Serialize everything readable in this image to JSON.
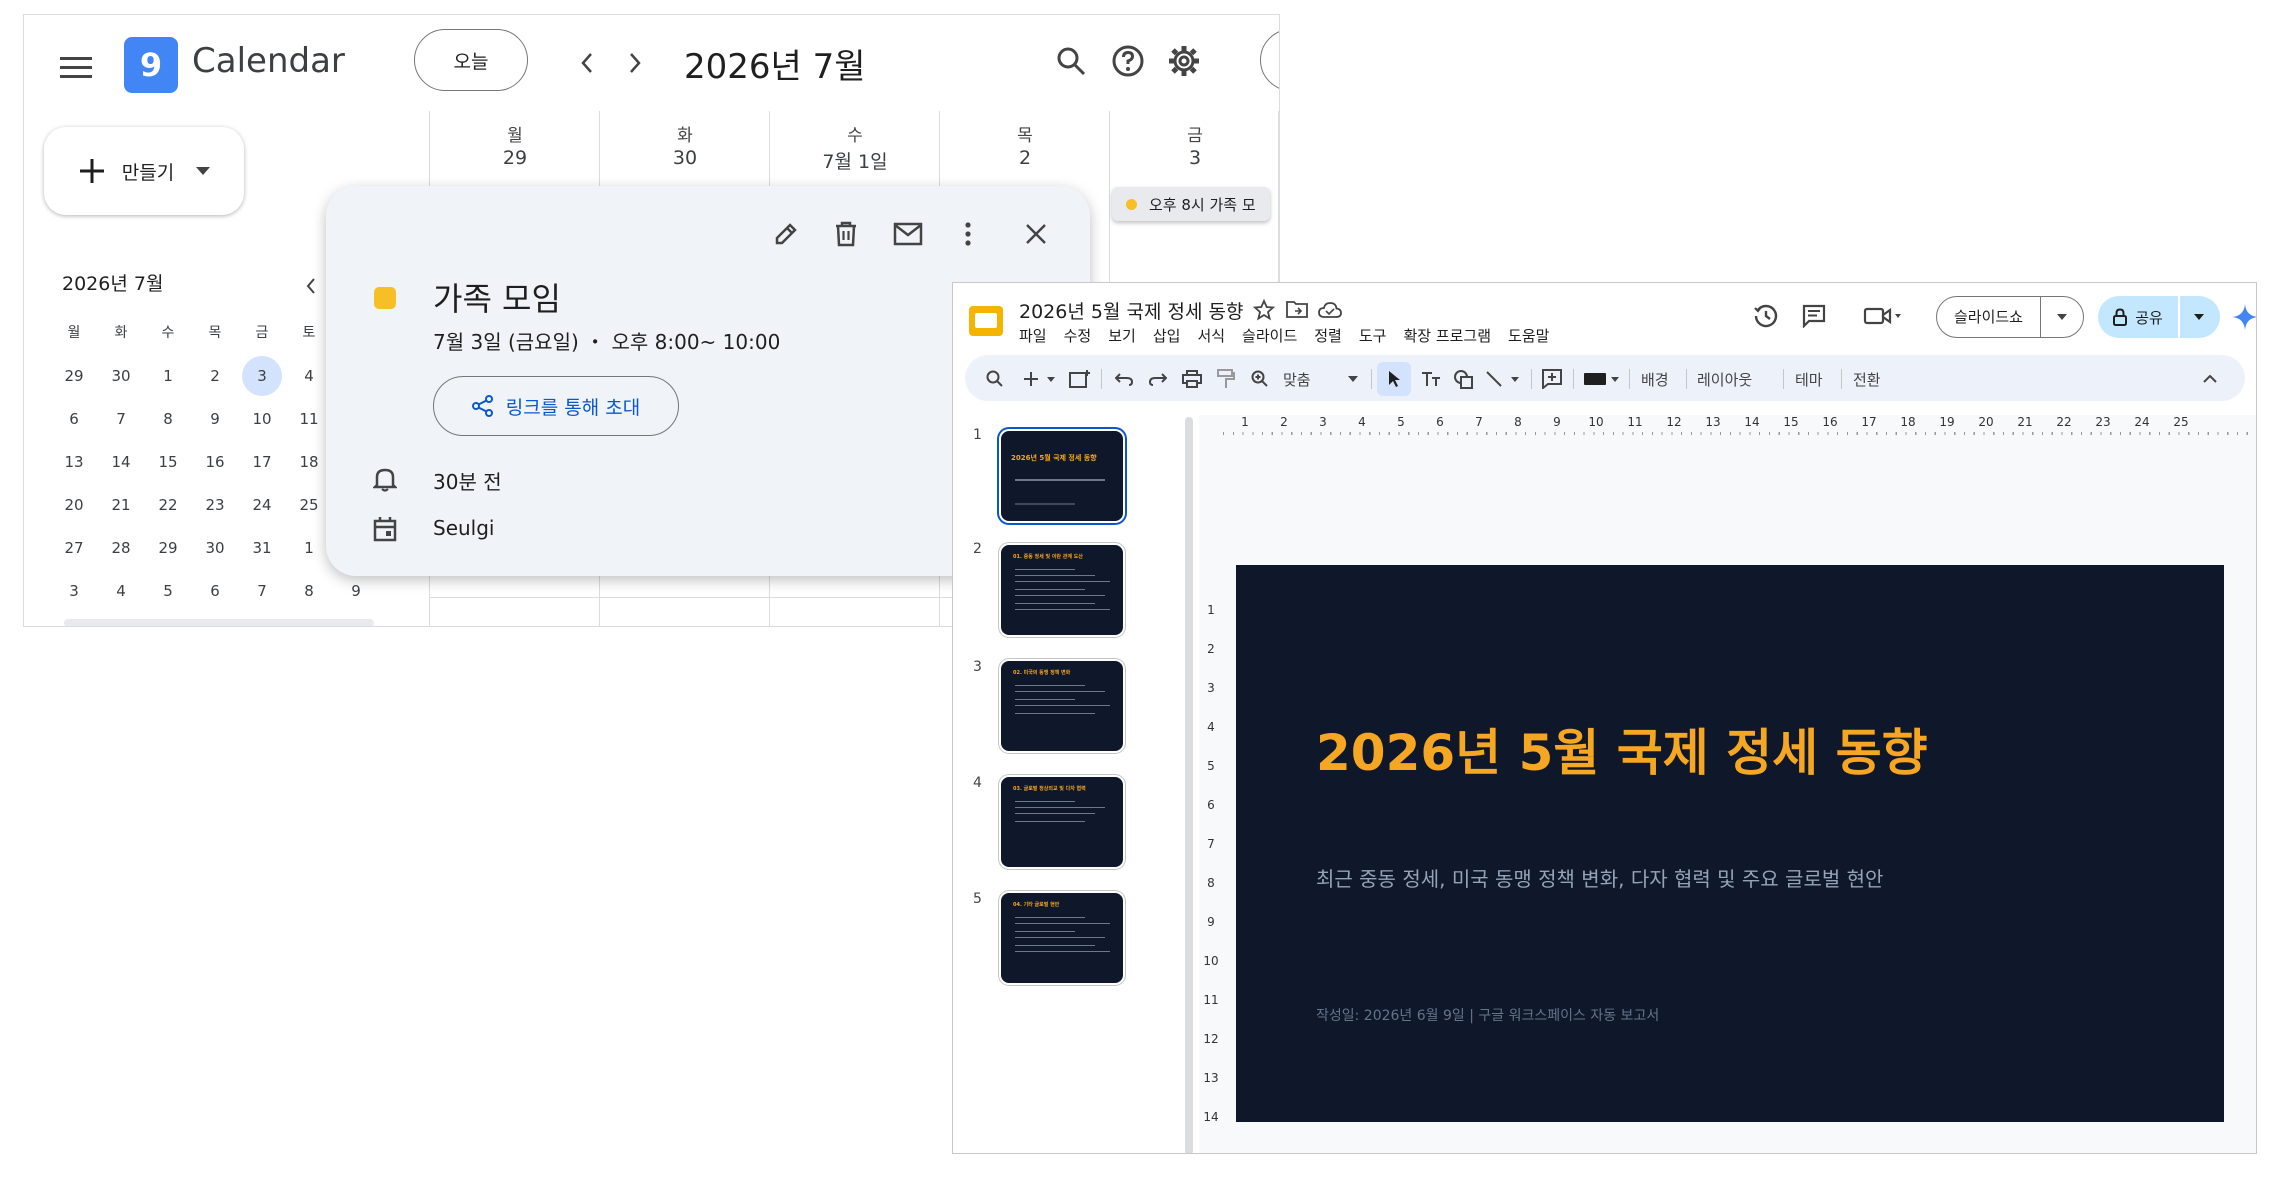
{
  "calendar": {
    "app_title": "Calendar",
    "logo_digit": "9",
    "today_btn": "오늘",
    "period_title": "2026년 7월",
    "create_btn": "만들기",
    "week_days": [
      {
        "name": "월",
        "num": "29"
      },
      {
        "name": "화",
        "num": "30"
      },
      {
        "name": "수",
        "num": "7월 1일"
      },
      {
        "name": "목",
        "num": "2"
      },
      {
        "name": "금",
        "num": "3"
      }
    ],
    "event_chip": "오후 8시 가족 모",
    "mini": {
      "title": "2026년 7월",
      "headers": [
        "월",
        "화",
        "수",
        "목",
        "금",
        "토",
        ""
      ],
      "weeks": [
        [
          "29",
          "30",
          "1",
          "2",
          "3",
          "4",
          ""
        ],
        [
          "6",
          "7",
          "8",
          "9",
          "10",
          "11",
          ""
        ],
        [
          "13",
          "14",
          "15",
          "16",
          "17",
          "18",
          ""
        ],
        [
          "20",
          "21",
          "22",
          "23",
          "24",
          "25",
          ""
        ],
        [
          "27",
          "28",
          "29",
          "30",
          "31",
          "1",
          ""
        ],
        [
          "3",
          "4",
          "5",
          "6",
          "7",
          "8",
          "9"
        ]
      ],
      "selected": "3"
    },
    "popup": {
      "title": "가족 모임",
      "datetime": "7월 3일 (금요일) ・ 오후 8:00~ 10:00",
      "invite_btn": "링크를 통해 초대",
      "reminder": "30분 전",
      "calendar_owner": "Seulgi",
      "event_color": "#f6bf26"
    }
  },
  "slides": {
    "doc_title": "2026년 5월 국제 정세 동향",
    "menu": [
      "파일",
      "수정",
      "보기",
      "삽입",
      "서식",
      "슬라이드",
      "정렬",
      "도구",
      "확장 프로그램",
      "도움말"
    ],
    "slideshow_btn": "슬라이드쇼",
    "share_btn": "공유",
    "toolbar": {
      "zoom": "맞춤",
      "background": "배경",
      "layout": "레이아웃",
      "theme": "테마",
      "transition": "전환"
    },
    "ruler_h": [
      "1",
      "2",
      "3",
      "4",
      "5",
      "6",
      "7",
      "8",
      "9",
      "10",
      "11",
      "12",
      "13",
      "14",
      "15",
      "16",
      "17",
      "18",
      "19",
      "20",
      "21",
      "22",
      "23",
      "24",
      "25"
    ],
    "ruler_v": [
      "1",
      "2",
      "3",
      "4",
      "5",
      "6",
      "7",
      "8",
      "9",
      "10",
      "11",
      "12",
      "13",
      "14"
    ],
    "thumbnails": [
      {
        "num": "1",
        "heading": "2026년 5월 국제 정세 동향"
      },
      {
        "num": "2",
        "heading": "01. 중동 정세 및 이란 관계 도산"
      },
      {
        "num": "3",
        "heading": "02. 미국의 동맹 정책 변화"
      },
      {
        "num": "4",
        "heading": "03. 글로벌 정상외교 및 다자 협력"
      },
      {
        "num": "5",
        "heading": "04. 기타 글로벌 현안"
      }
    ],
    "slide": {
      "title": "2026년 5월 국제 정세 동향",
      "subtitle": "최근 중동 정세, 미국 동맹 정책 변화, 다자 협력 및 주요 글로벌 현안",
      "footer": "작성일: 2026년 6월 9일  |  구글 워크스페이스 자동 보고서"
    },
    "colors": {
      "slide_bg": "#0f172a",
      "title": "#f5a623",
      "share_bg": "#c2e7ff"
    }
  }
}
